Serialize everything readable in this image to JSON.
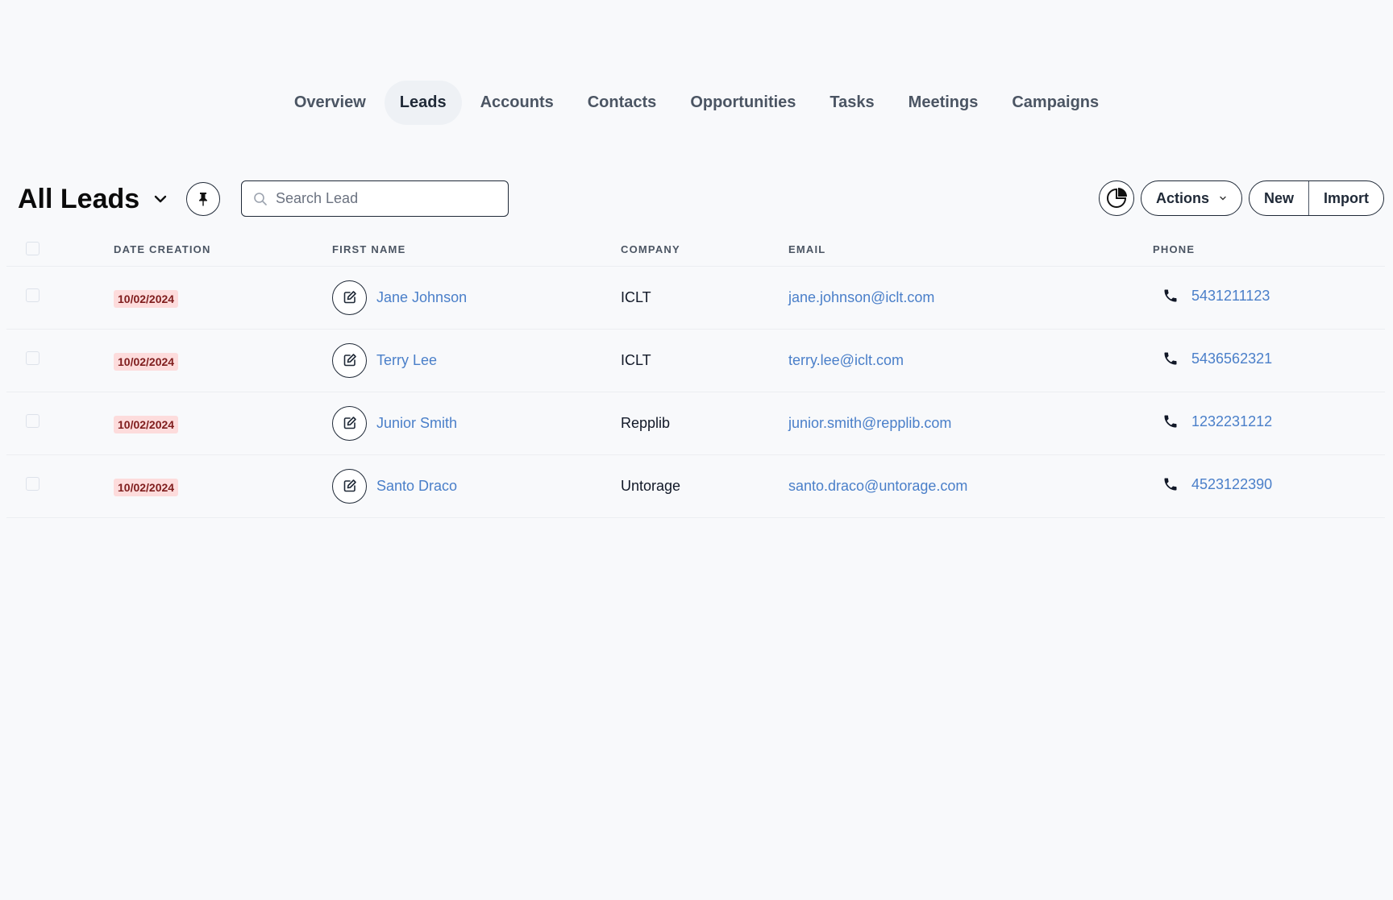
{
  "nav": {
    "tabs": [
      {
        "label": "Overview",
        "active": false
      },
      {
        "label": "Leads",
        "active": true
      },
      {
        "label": "Accounts",
        "active": false
      },
      {
        "label": "Contacts",
        "active": false
      },
      {
        "label": "Opportunities",
        "active": false
      },
      {
        "label": "Tasks",
        "active": false
      },
      {
        "label": "Meetings",
        "active": false
      },
      {
        "label": "Campaigns",
        "active": false
      }
    ]
  },
  "toolbar": {
    "title": "All Leads",
    "title_icon": "chevron-down-icon",
    "pin_icon": "pin-icon",
    "search_placeholder": "Search Lead",
    "search_value": "",
    "chart_icon": "pie-chart-icon",
    "actions_label": "Actions",
    "new_label": "New",
    "import_label": "Import"
  },
  "table": {
    "columns": [
      "DATE CREATION",
      "FIRST NAME",
      "COMPANY",
      "EMAIL",
      "PHONE"
    ],
    "rows": [
      {
        "date": "10/02/2024",
        "name": "Jane Johnson",
        "company": "ICLT",
        "email": "jane.johnson@iclt.com",
        "phone": "5431211123"
      },
      {
        "date": "10/02/2024",
        "name": "Terry Lee",
        "company": "ICLT",
        "email": "terry.lee@iclt.com",
        "phone": "5436562321"
      },
      {
        "date": "10/02/2024",
        "name": "Junior Smith",
        "company": "Repplib",
        "email": "junior.smith@repplib.com",
        "phone": "1232231212"
      },
      {
        "date": "10/02/2024",
        "name": "Santo Draco",
        "company": "Untorage",
        "email": "santo.draco@untorage.com",
        "phone": "4523122390"
      }
    ]
  },
  "colors": {
    "link": "#4a7fc9",
    "date_badge_bg": "#fddcdc",
    "date_badge_text": "#7f1d1d",
    "active_tab_bg": "#eef1f5",
    "background": "#f8f9fb"
  }
}
